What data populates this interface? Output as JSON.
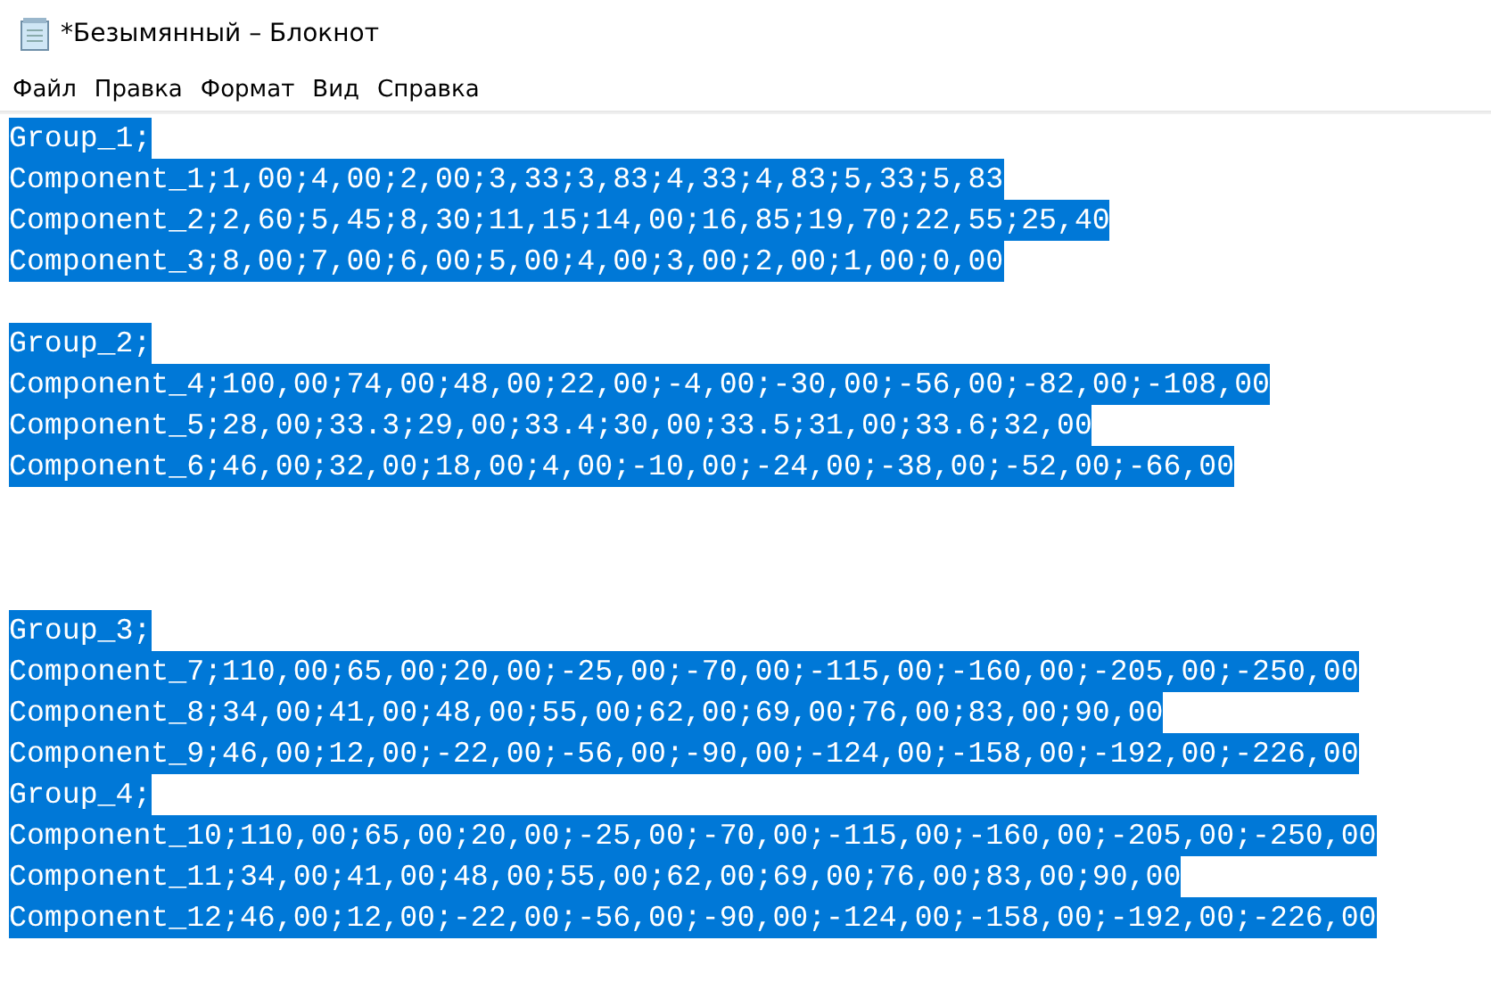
{
  "window": {
    "title": "*Безымянный – Блокнот"
  },
  "menu": [
    "Файл",
    "Правка",
    "Формат",
    "Вид",
    "Справка"
  ],
  "editor": {
    "lines": [
      {
        "kind": "text",
        "text": "Group_1;",
        "selected": true
      },
      {
        "kind": "text",
        "text": "Component_1;1,00;4,00;2,00;3,33;3,83;4,33;4,83;5,33;5,83",
        "selected": true
      },
      {
        "kind": "text",
        "text": "Component_2;2,60;5,45;8,30;11,15;14,00;16,85;19,70;22,55;25,40",
        "selected": true
      },
      {
        "kind": "text",
        "text": "Component_3;8,00;7,00;6,00;5,00;4,00;3,00;2,00;1,00;0,00",
        "selected": true
      },
      {
        "kind": "blank"
      },
      {
        "kind": "text",
        "text": "Group_2;",
        "selected": true
      },
      {
        "kind": "text",
        "text": "Component_4;100,00;74,00;48,00;22,00;-4,00;-30,00;-56,00;-82,00;-108,00",
        "selected": true
      },
      {
        "kind": "text",
        "text": "Component_5;28,00;33.3;29,00;33.4;30,00;33.5;31,00;33.6;32,00",
        "selected": true
      },
      {
        "kind": "text",
        "text": "Component_6;46,00;32,00;18,00;4,00;-10,00;-24,00;-38,00;-52,00;-66,00",
        "selected": true
      },
      {
        "kind": "blank"
      },
      {
        "kind": "blank"
      },
      {
        "kind": "blank"
      },
      {
        "kind": "text",
        "text": "Group_3;",
        "selected": true
      },
      {
        "kind": "text",
        "text": "Component_7;110,00;65,00;20,00;-25,00;-70,00;-115,00;-160,00;-205,00;-250,00",
        "selected": true
      },
      {
        "kind": "text",
        "text": "Component_8;34,00;41,00;48,00;55,00;62,00;69,00;76,00;83,00;90,00",
        "selected": true
      },
      {
        "kind": "text",
        "text": "Component_9;46,00;12,00;-22,00;-56,00;-90,00;-124,00;-158,00;-192,00;-226,00",
        "selected": true
      },
      {
        "kind": "text",
        "text": "Group_4;",
        "selected": true
      },
      {
        "kind": "text",
        "text": "Component_10;110,00;65,00;20,00;-25,00;-70,00;-115,00;-160,00;-205,00;-250,00",
        "selected": true
      },
      {
        "kind": "text",
        "text": "Component_11;34,00;41,00;48,00;55,00;62,00;69,00;76,00;83,00;90,00",
        "selected": true
      },
      {
        "kind": "text",
        "text": "Component_12;46,00;12,00;-22,00;-56,00;-90,00;-124,00;-158,00;-192,00;-226,00",
        "selected": true
      }
    ]
  }
}
